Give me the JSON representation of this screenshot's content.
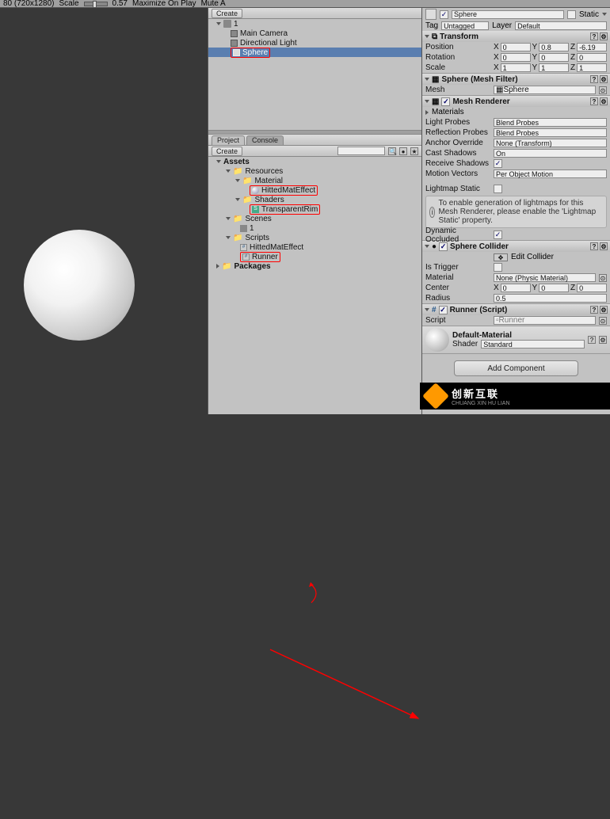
{
  "topbar": {
    "res": "80 (720x1280)",
    "scale_lbl": "Scale",
    "scale_val": "0.57",
    "max": "Maximize On Play",
    "mute": "Mute A"
  },
  "hier": {
    "create": "Create",
    "scene": "1",
    "items": [
      "Main Camera",
      "Directional Light",
      "Sphere"
    ]
  },
  "proj": {
    "tab1": "Project",
    "tab2": "Console",
    "create": "Create",
    "root": "Assets",
    "res": "Resources",
    "mat_folder": "Material",
    "mat": "HittedMatEffect",
    "sh_folder": "Shaders",
    "sh": "TransparentRim",
    "scenes": "Scenes",
    "scene1": "1",
    "scripts": "Scripts",
    "script1": "HittedMatEffect",
    "script2": "Runner",
    "packages": "Packages"
  },
  "insp": {
    "name": "Sphere",
    "static": "Static",
    "tag_lbl": "Tag",
    "tag_val": "Untagged",
    "layer_lbl": "Layer",
    "layer_val": "Default",
    "transform": "Transform",
    "position": "Position",
    "px": "0",
    "py": "0.8",
    "pz": "-6.19",
    "rotation": "Rotation",
    "rx": "0",
    "ry": "0",
    "rz": "0",
    "scale": "Scale",
    "sx": "1",
    "sy": "1",
    "sz": "1",
    "meshfilter": "Sphere (Mesh Filter)",
    "mesh_lbl": "Mesh",
    "mesh_val": "Sphere",
    "renderer": "Mesh Renderer",
    "materials": "Materials",
    "lightprobes_lbl": "Light Probes",
    "lightprobes_val": "Blend Probes",
    "refprobes_lbl": "Reflection Probes",
    "refprobes_val": "Blend Probes",
    "anchor_lbl": "Anchor Override",
    "anchor_val": "None (Transform)",
    "castsh_lbl": "Cast Shadows",
    "castsh_val": "On",
    "recvsh_lbl": "Receive Shadows",
    "motion_lbl": "Motion Vectors",
    "motion_val": "Per Object Motion",
    "lmstatic_lbl": "Lightmap Static",
    "lm_info": "To enable generation of lightmaps for this Mesh Renderer, please enable the 'Lightmap Static' property.",
    "dynocc_lbl": "Dynamic Occluded",
    "collider": "Sphere Collider",
    "editcol": "Edit Collider",
    "trigger_lbl": "Is Trigger",
    "colmat_lbl": "Material",
    "colmat_val": "None (Physic Material)",
    "center_lbl": "Center",
    "cx": "0",
    "cy": "0",
    "cz": "0",
    "radius_lbl": "Radius",
    "radius_val": "0.5",
    "runner": "Runner (Script)",
    "script_lbl": "Script",
    "script_val": "Runner",
    "defmat": "Default-Material",
    "shader_lbl": "Shader",
    "shader_val": "Standard",
    "addcomp": "Add Component"
  },
  "brand": {
    "cn": "创新互联",
    "en": "CHUANG XIN HU LIAN"
  }
}
